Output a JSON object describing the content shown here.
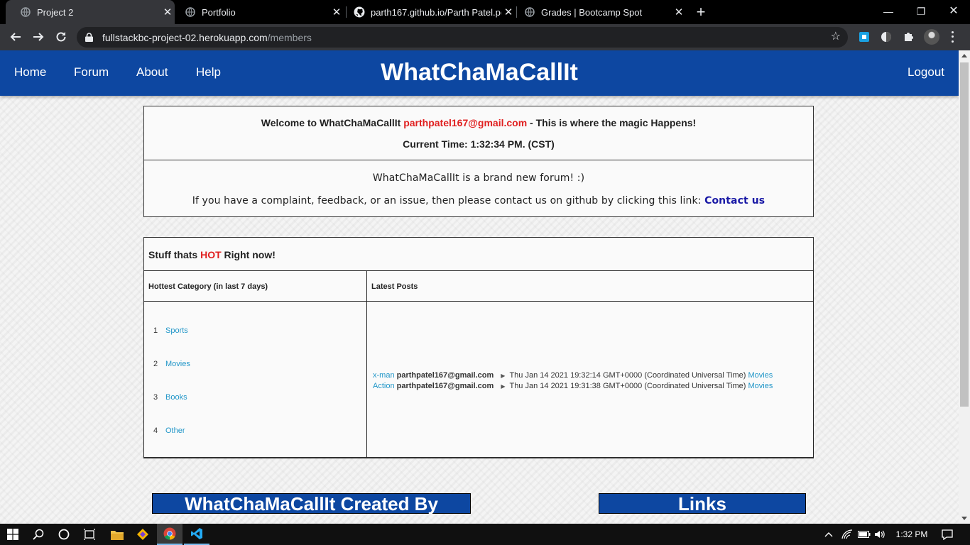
{
  "browser": {
    "tabs": [
      {
        "title": "Project 2",
        "icon": "globe-icon"
      },
      {
        "title": "Portfolio",
        "icon": "globe-icon"
      },
      {
        "title": "parth167.github.io/Parth Patel.pd",
        "icon": "github-icon"
      },
      {
        "title": "Grades | Bootcamp Spot",
        "icon": "globe-icon"
      }
    ],
    "url_host": "fullstackbc-project-02.herokuapp.com",
    "url_path": "/members"
  },
  "site": {
    "nav": {
      "home": "Home",
      "forum": "Forum",
      "about": "About",
      "help": "Help",
      "logout": "Logout"
    },
    "brand": "WhatChaMaCallIt"
  },
  "welcome": {
    "prefix": "Welcome to WhatChaMaCallIt ",
    "email": "parthpatel167@gmail.com",
    "suffix": " - This is where the magic Happens!",
    "time_label": "Current Time: 1:32:34 PM. (CST)"
  },
  "info": {
    "line1": "WhatChaMaCallIt is a brand new forum! :)",
    "line2": "If you have a complaint, feedback, or an issue, then please contact us on github by clicking this link: ",
    "contact_link": "Contact us"
  },
  "hot": {
    "prefix": "Stuff thats ",
    "hot_word": "HOT",
    "suffix": " Right now!",
    "col_category": "Hottest Category (in last 7 days)",
    "col_posts": "Latest Posts",
    "categories": [
      {
        "num": "1",
        "name": "Sports"
      },
      {
        "num": "2",
        "name": "Movies"
      },
      {
        "num": "3",
        "name": "Books"
      },
      {
        "num": "4",
        "name": "Other"
      }
    ],
    "posts": [
      {
        "title": "x-man",
        "author": "parthpatel167@gmail.com",
        "date": "Thu Jan 14 2021 19:32:14 GMT+0000 (Coordinated Universal Time)",
        "category": "Movies"
      },
      {
        "title": "Action",
        "author": "parthpatel167@gmail.com",
        "date": "Thu Jan 14 2021 19:31:38 GMT+0000 (Coordinated Universal Time)",
        "category": "Movies"
      }
    ]
  },
  "footer": {
    "created_by": "WhatChaMaCallIt Created By",
    "links": "Links"
  },
  "taskbar": {
    "clock": "1:32 PM"
  },
  "colors": {
    "brand_blue": "#0d47a1",
    "hot_red": "#e02020",
    "link_blue": "#2196c8"
  }
}
